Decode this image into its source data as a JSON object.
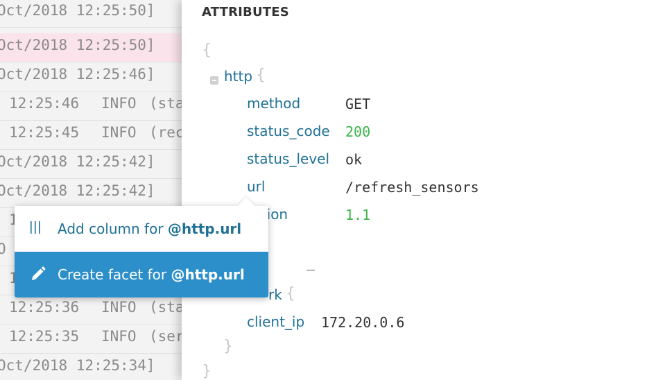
{
  "log_rows": [
    {
      "timestamp": "Oct/2018 12:25:50]",
      "level": "",
      "message": "",
      "highlighted": false
    },
    {
      "timestamp": "Oct/2018 12:25:50]",
      "level": "",
      "message": "",
      "highlighted": true
    },
    {
      "timestamp": "Oct/2018 12:25:46]",
      "level": "",
      "message": "",
      "highlighted": false
    },
    {
      "timestamp": "12:25:46",
      "level": "INFO",
      "message": "(sta",
      "highlighted": false
    },
    {
      "timestamp": "12:25:45",
      "level": "INFO",
      "message": "(rec",
      "highlighted": false
    },
    {
      "timestamp": "Oct/2018 12:25:42]",
      "level": "",
      "message": "",
      "highlighted": false
    },
    {
      "timestamp": "Oct/2018 12:25:42]",
      "level": "",
      "message": "",
      "highlighted": false
    },
    {
      "timestamp": "1",
      "level": "",
      "message": "",
      "highlighted": false
    },
    {
      "timestamp": "O",
      "level": "",
      "message": "",
      "highlighted": false
    },
    {
      "timestamp": "1",
      "level": "",
      "message": "",
      "highlighted": false
    },
    {
      "timestamp": "12:25:36",
      "level": "INFO",
      "message": "(sta",
      "highlighted": false
    },
    {
      "timestamp": "12:25:35",
      "level": "INFO",
      "message": "(ser",
      "highlighted": false
    },
    {
      "timestamp": "Oct/2018 12:25:34]",
      "level": "",
      "message": "",
      "highlighted": false
    }
  ],
  "attributes_panel": {
    "title": "ATTRIBUTES",
    "open_brace": "{",
    "close_brace": "}",
    "http": {
      "key": "http",
      "brace_open": "{",
      "fields": [
        {
          "key": "method",
          "value": "GET"
        },
        {
          "key": "status_code",
          "value": "200"
        },
        {
          "key": "status_level",
          "value": "ok"
        },
        {
          "key": "url",
          "value": "/refresh_sensors"
        },
        {
          "key": "rsion",
          "value": "1.1"
        }
      ],
      "dash": "_"
    },
    "network": {
      "key": "rk",
      "brace_open": "{",
      "fields": [
        {
          "key": "client_ip",
          "value": "172.20.0.6"
        }
      ],
      "brace_close": "}"
    }
  },
  "context_menu": {
    "items": [
      {
        "prefix": "Add column for ",
        "attr": "@http.url",
        "icon": "columns-icon"
      },
      {
        "prefix": "Create facet for ",
        "attr": "@http.url",
        "icon": "pencil-icon"
      }
    ]
  },
  "colors": {
    "key": "#1f7196",
    "number": "#3bb54a",
    "highlight_row": "#fbe3ec",
    "menu_active": "#2d8fc9"
  }
}
